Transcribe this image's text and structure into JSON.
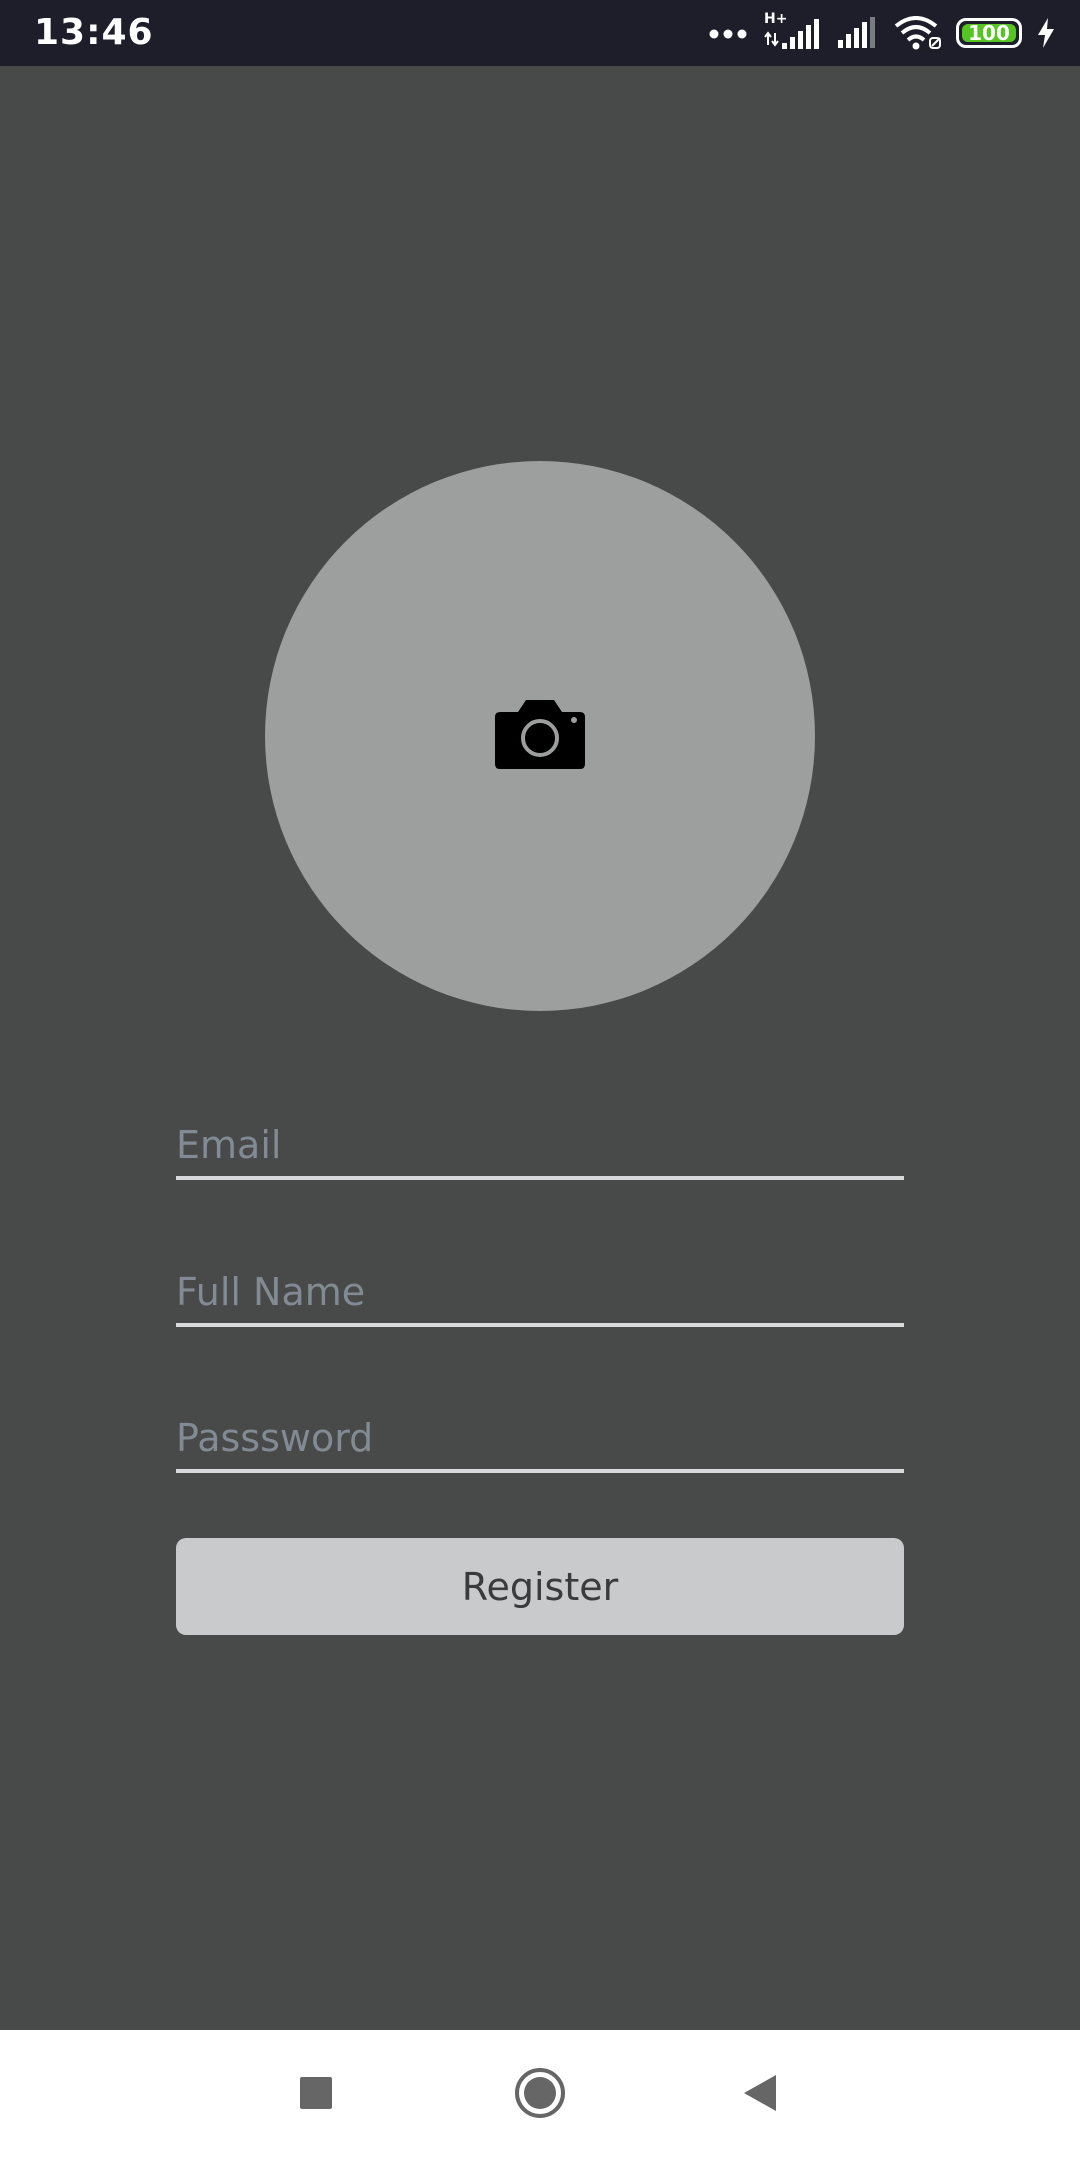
{
  "status_bar": {
    "time": "13:46",
    "network_type": "H+",
    "battery_level": "100",
    "icons": [
      "more-dots-icon",
      "signal-icon",
      "signal-icon",
      "wifi-icon",
      "battery-icon",
      "charging-icon"
    ]
  },
  "avatar": {
    "icon": "camera-icon"
  },
  "form": {
    "email_placeholder": "Email",
    "email_value": "",
    "name_placeholder": "Full Name",
    "name_value": "",
    "password_placeholder": "Passsword",
    "password_value": "",
    "register_label": "Register"
  },
  "nav_bar": {
    "icons": [
      "recent-apps-icon",
      "home-icon",
      "back-icon"
    ]
  },
  "colors": {
    "background": "#484949",
    "avatar_fill": "#9d9f9e",
    "button_fill": "#c9cacc",
    "placeholder": "#828b93",
    "status_bar": "#1d1e2a",
    "battery": "#54c521"
  }
}
